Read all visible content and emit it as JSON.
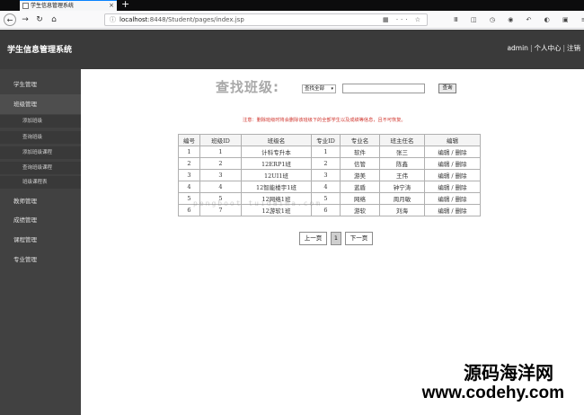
{
  "browser": {
    "tab_title": "学生信息管理系统",
    "new_tab": "+",
    "close": "×",
    "url_host": "localhost",
    "url_rest": ":8448/Student/pages/index.jsp",
    "url_icons": "▦ ··· ☆",
    "toolbar_icons": "Ⅲ ◫ ◷ ◉ ↶ ◐ ▣ ≡"
  },
  "app": {
    "title": "学生信息管理系统",
    "user": "admin",
    "personal_center": "个人中心",
    "logout": "注销"
  },
  "sidebar": {
    "items": [
      {
        "label": "学生管理"
      },
      {
        "label": "班级管理"
      },
      {
        "label": "教师管理"
      },
      {
        "label": "成绩管理"
      },
      {
        "label": "课程管理"
      },
      {
        "label": "专业管理"
      }
    ],
    "subitems": [
      {
        "label": "添加班级"
      },
      {
        "label": "查询班级"
      },
      {
        "label": "添加班级课程"
      },
      {
        "label": "查询班级课程"
      },
      {
        "label": "班级课程表"
      }
    ]
  },
  "search": {
    "title": "查找班级:",
    "select_value": "查找全部",
    "input_value": "",
    "button": "查询"
  },
  "notice": "注意：删除班级时将会删除该班级下的全部学生以及成绩等信息，且不可恢复。",
  "table": {
    "headers": [
      "编号",
      "班级ID",
      "班级名",
      "专业ID",
      "专业名",
      "班主任名",
      "编辑"
    ],
    "edit_label": "编辑",
    "edit_sep": "/",
    "delete_label": "删除",
    "rows": [
      {
        "no": "1",
        "class_id": "1",
        "class_name": "计科专升本",
        "major_id": "1",
        "major_name": "软件",
        "teacher": "张三"
      },
      {
        "no": "2",
        "class_id": "2",
        "class_name": "12ERP1班",
        "major_id": "2",
        "major_name": "信管",
        "teacher": "陈鑫"
      },
      {
        "no": "3",
        "class_id": "3",
        "class_name": "12UI1班",
        "major_id": "3",
        "major_name": "游美",
        "teacher": "王伟"
      },
      {
        "no": "4",
        "class_id": "4",
        "class_name": "12智能楼宇1班",
        "major_id": "4",
        "major_name": "蓝盾",
        "teacher": "钟宁涛"
      },
      {
        "no": "5",
        "class_id": "5",
        "class_name": "12网络1班",
        "major_id": "5",
        "major_name": "网络",
        "teacher": "周月敏"
      },
      {
        "no": "6",
        "class_id": "7",
        "class_name": "12游软1班",
        "major_id": "6",
        "major_name": "游软",
        "teacher": "刘海"
      }
    ]
  },
  "pager": {
    "prev": "上一页",
    "current": "1",
    "next": "下一页"
  },
  "watermark": {
    "line": "pengboot  tuidaima.com",
    "brand_cn": "源码海洋网",
    "brand_url": "www.codehy.com"
  }
}
